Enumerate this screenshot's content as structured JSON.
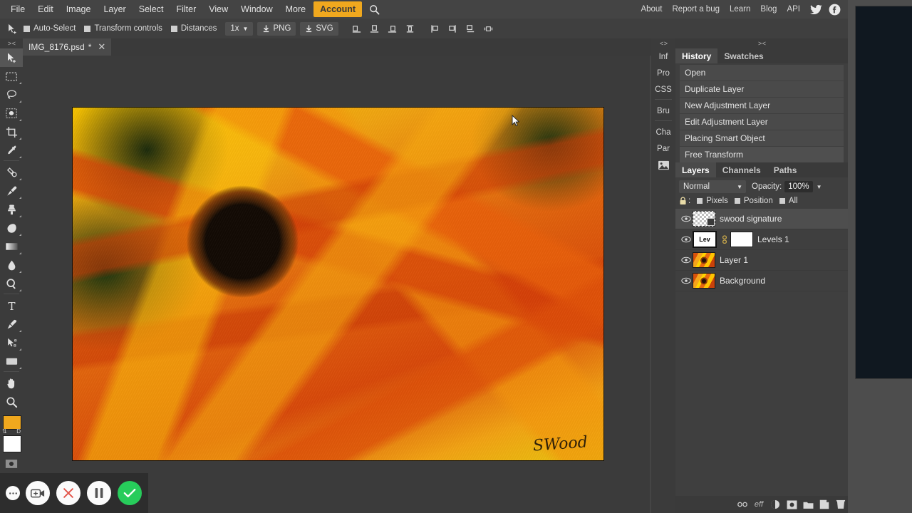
{
  "menubar": {
    "left_items": [
      {
        "label": "File",
        "name": "menu-file"
      },
      {
        "label": "Edit",
        "name": "menu-edit"
      },
      {
        "label": "Image",
        "name": "menu-image"
      },
      {
        "label": "Layer",
        "name": "menu-layer"
      },
      {
        "label": "Select",
        "name": "menu-select"
      },
      {
        "label": "Filter",
        "name": "menu-filter"
      },
      {
        "label": "View",
        "name": "menu-view"
      },
      {
        "label": "Window",
        "name": "menu-window"
      },
      {
        "label": "More",
        "name": "menu-more"
      }
    ],
    "account_label": "Account",
    "search_icon": "search-icon",
    "right_items": [
      {
        "label": "About"
      },
      {
        "label": "Report a bug"
      },
      {
        "label": "Learn"
      },
      {
        "label": "Blog"
      },
      {
        "label": "API"
      }
    ],
    "social": [
      {
        "name": "twitter-icon"
      },
      {
        "name": "facebook-icon"
      }
    ],
    "accent_color": "#f0a81e"
  },
  "optionsbar": {
    "active_tool_icon": "move-tool-icon",
    "checkboxes": [
      {
        "label": "Auto-Select",
        "checked": true
      },
      {
        "label": "Transform controls",
        "checked": true
      },
      {
        "label": "Distances",
        "checked": true
      }
    ],
    "zoom_select": "1x",
    "export_png": "PNG",
    "export_svg": "SVG",
    "align_icons": [
      "align-bottom-edges-icon",
      "align-vertical-centers-icon",
      "align-top-edges-icon",
      "distribute-vertical-icon"
    ],
    "distribute_icons": [
      "align-left-edges-icon",
      "align-horizontal-centers-icon",
      "align-right-edges-icon",
      "distribute-horizontal-icon"
    ]
  },
  "tabstrip": {
    "collapse_glyph": "> <",
    "document_name": "IMG_8176.psd",
    "modified_marker": "*",
    "close_glyph": "✕"
  },
  "toolbar": {
    "collapse_glyph": "> <",
    "tools": [
      {
        "name": "move-tool",
        "icon": "move-tool-icon",
        "active": true,
        "corner": false
      },
      {
        "name": "rectangular-marquee-tool",
        "icon": "rectangular-marquee-icon",
        "active": false,
        "corner": true
      },
      {
        "name": "lasso-tool",
        "icon": "lasso-icon",
        "active": false,
        "corner": true
      },
      {
        "name": "quick-selection-tool",
        "icon": "magic-wand-icon",
        "active": false,
        "corner": true
      },
      {
        "name": "crop-tool",
        "icon": "crop-icon",
        "active": false,
        "corner": true
      },
      {
        "name": "eyedropper-tool",
        "icon": "eyedropper-icon",
        "active": false,
        "corner": true
      },
      {
        "name": "healing-brush-tool",
        "icon": "healing-brush-icon",
        "active": false,
        "corner": true
      },
      {
        "name": "brush-tool",
        "icon": "paintbrush-icon",
        "active": false,
        "corner": true
      },
      {
        "name": "clone-stamp-tool",
        "icon": "clone-stamp-icon",
        "active": false,
        "corner": true
      },
      {
        "name": "eraser-tool",
        "icon": "eraser-icon",
        "active": false,
        "corner": true
      },
      {
        "name": "gradient-tool",
        "icon": "gradient-icon",
        "active": false,
        "corner": true
      },
      {
        "name": "blur-tool",
        "icon": "blur-drop-icon",
        "active": false,
        "corner": true
      },
      {
        "name": "dodge-tool",
        "icon": "dodge-icon",
        "active": false,
        "corner": true
      },
      {
        "name": "type-tool",
        "icon": "type-t-icon",
        "active": false,
        "corner": false
      },
      {
        "name": "pen-tool",
        "icon": "pen-icon",
        "active": false,
        "corner": true
      },
      {
        "name": "path-selection-tool",
        "icon": "path-arrow-icon",
        "active": false,
        "corner": true
      },
      {
        "name": "shape-tool",
        "icon": "rectangle-shape-icon",
        "active": false,
        "corner": true
      },
      {
        "name": "hand-tool",
        "icon": "hand-icon",
        "active": false,
        "corner": false
      },
      {
        "name": "zoom-tool",
        "icon": "magnifier-icon",
        "active": false,
        "corner": false
      }
    ],
    "foreground_color": "#f0a81e",
    "background_color": "#ffffff",
    "swap_label": "⇅",
    "default_label": "D",
    "quickmask_icon": "quick-mask-icon"
  },
  "canvas": {
    "image_alt": "orange flower macro photograph",
    "signature_text": "SWood"
  },
  "rightdock": {
    "vertical_tabs": [
      {
        "label": "Inf"
      },
      {
        "label": "Pro"
      },
      {
        "label": "CSS"
      },
      {
        "label": "Bru"
      },
      {
        "label": "Cha"
      },
      {
        "label": "Par"
      }
    ],
    "vertical_tab_icon": "image-thumbnail-icon",
    "collapse_glyph_left": "< >",
    "collapse_glyph_right": "> <"
  },
  "history_panel": {
    "tabs": [
      {
        "label": "History",
        "selected": true
      },
      {
        "label": "Swatches",
        "selected": false
      }
    ],
    "items": [
      {
        "label": "Open",
        "current": false
      },
      {
        "label": "Duplicate Layer",
        "current": false
      },
      {
        "label": "New Adjustment Layer",
        "current": false
      },
      {
        "label": "Edit Adjustment Layer",
        "current": false
      },
      {
        "label": "Placing Smart Object",
        "current": false
      },
      {
        "label": "Free Transform",
        "current": true
      }
    ]
  },
  "layers_panel": {
    "tabs": [
      {
        "label": "Layers",
        "selected": true
      },
      {
        "label": "Channels",
        "selected": false
      },
      {
        "label": "Paths",
        "selected": false
      }
    ],
    "blend_mode": "Normal",
    "opacity_label": "Opacity:",
    "opacity_value": "100%",
    "lock_label": ":",
    "lock_icon": "lock-icon",
    "lock_options": [
      {
        "label": "Pixels"
      },
      {
        "label": "Position"
      },
      {
        "label": "All"
      }
    ],
    "layers": [
      {
        "name": "swood signature",
        "thumb": "transparent-checker",
        "selected": true,
        "visible": true,
        "smart_object": true
      },
      {
        "name": "Levels 1",
        "thumb": "levels-adjustment",
        "thumb_label": "Lev",
        "mask": true,
        "linked": true,
        "selected": false,
        "visible": true
      },
      {
        "name": "Layer 1",
        "thumb": "flower-photo",
        "selected": false,
        "visible": true
      },
      {
        "name": "Background",
        "thumb": "flower-photo",
        "selected": false,
        "visible": true
      }
    ],
    "footer_icons": [
      "link-layers-icon",
      "layer-effects-icon",
      "adjustment-layer-icon",
      "layer-mask-icon",
      "new-group-icon",
      "new-layer-icon",
      "delete-layer-icon"
    ]
  },
  "recorder": {
    "buttons": [
      {
        "name": "more-options-button",
        "icon": "ellipsis-icon"
      },
      {
        "name": "add-recording-button",
        "icon": "camera-plus-icon"
      },
      {
        "name": "cancel-recording-button",
        "icon": "close-x-icon"
      },
      {
        "name": "pause-recording-button",
        "icon": "pause-icon"
      },
      {
        "name": "finish-recording-button",
        "icon": "checkmark-icon"
      }
    ],
    "accent_color": "#27cc5b"
  }
}
